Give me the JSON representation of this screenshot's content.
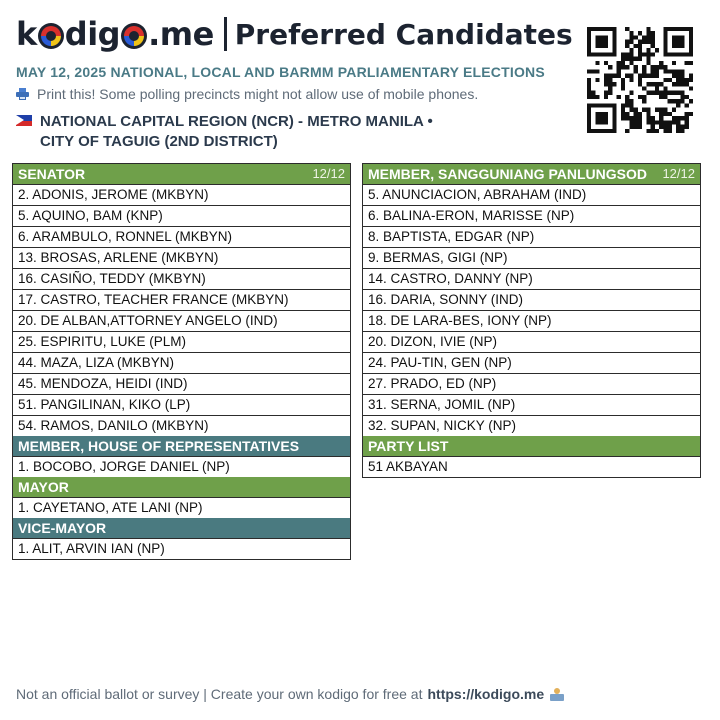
{
  "header": {
    "logo": {
      "pre": "k",
      "post": "dig",
      "dot_me": ".me"
    },
    "title": "Preferred Candidates",
    "subtitle": "MAY 12, 2025 NATIONAL, LOCAL AND BARMM PARLIAMENTARY ELECTIONS",
    "print_note": "Print this! Some polling precincts might not allow use of mobile phones.",
    "region_line1": "NATIONAL CAPITAL REGION (NCR) - METRO MANILA •",
    "region_line2": "CITY OF TAGUIG (2ND DISTRICT)",
    "icons": {
      "printer": "printer-icon",
      "flag": "philippine-flag-icon",
      "qr": "qr-code"
    }
  },
  "senator": {
    "title": "SENATOR",
    "count": "12/12",
    "items": [
      "2. ADONIS, JEROME (MKBYN)",
      "5. AQUINO, BAM (KNP)",
      "6. ARAMBULO, RONNEL (MKBYN)",
      "13. BROSAS, ARLENE (MKBYN)",
      "16. CASIÑO, TEDDY (MKBYN)",
      "17. CASTRO, TEACHER FRANCE (MKBYN)",
      "20. DE ALBAN,ATTORNEY ANGELO (IND)",
      "25. ESPIRITU, LUKE (PLM)",
      "44. MAZA, LIZA (MKBYN)",
      "45. MENDOZA, HEIDI (IND)",
      "51. PANGILINAN, KIKO (LP)",
      "54. RAMOS, DANILO (MKBYN)"
    ]
  },
  "house_rep": {
    "title": "MEMBER, HOUSE OF REPRESENTATIVES",
    "items": [
      "1. BOCOBO, JORGE DANIEL (NP)"
    ]
  },
  "mayor": {
    "title": "MAYOR",
    "items": [
      "1. CAYETANO, ATE LANI (NP)"
    ]
  },
  "vice_mayor": {
    "title": "VICE-MAYOR",
    "items": [
      "1. ALIT, ARVIN IAN (NP)"
    ]
  },
  "council": {
    "title": "MEMBER, SANGGUNIANG PANLUNGSOD",
    "count": "12/12",
    "items": [
      "5. ANUNCIACION, ABRAHAM (IND)",
      "6. BALINA-ERON, MARISSE (NP)",
      "8. BAPTISTA, EDGAR (NP)",
      "9. BERMAS, GIGI (NP)",
      "14. CASTRO, DANNY (NP)",
      "16. DARIA, SONNY (IND)",
      "18. DE LARA-BES, IONY (NP)",
      "20. DIZON, IVIE (NP)",
      "24. PAU-TIN, GEN (NP)",
      "27. PRADO, ED (NP)",
      "31. SERNA, JOMIL (NP)",
      "32. SUPAN, NICKY (NP)"
    ]
  },
  "party_list": {
    "title": "PARTY LIST",
    "items": [
      "51 AKBAYAN"
    ]
  },
  "footer": {
    "text": "Not an official ballot or survey | Create your own kodigo for free at",
    "link": "https://kodigo.me"
  },
  "colors": {
    "green": "#6fa04a",
    "teal": "#4a7a80",
    "subtitle": "#4a7a86",
    "dark": "#1c2330"
  }
}
